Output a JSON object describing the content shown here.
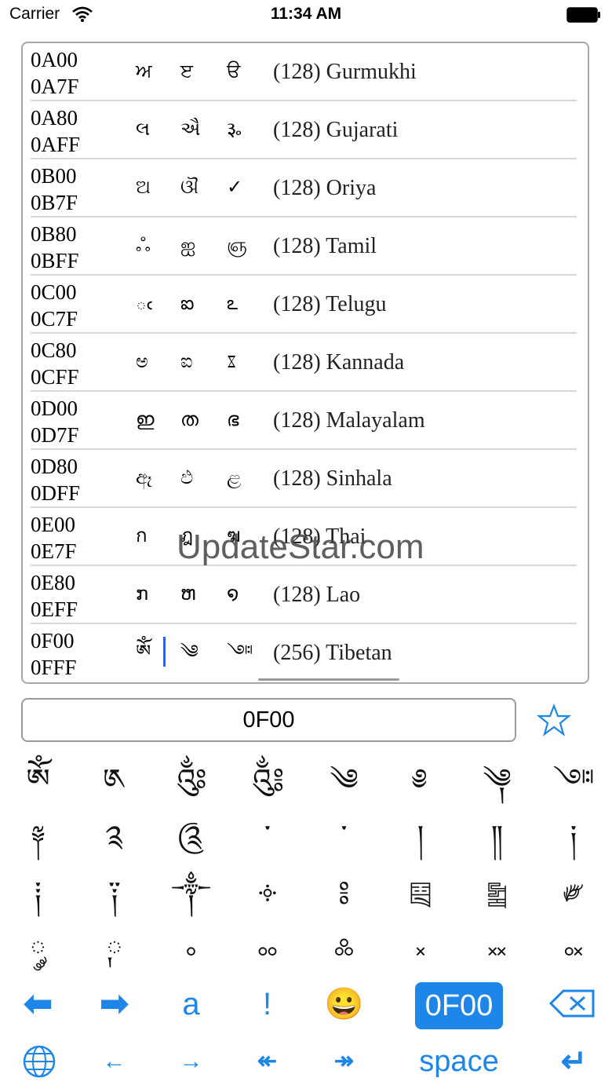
{
  "status": {
    "carrier": "Carrier",
    "time": "11:34 AM"
  },
  "rows": [
    {
      "start": "0A00",
      "end": "0A7F",
      "g1": "ਅ",
      "g2": "ੲ",
      "g3": "ੳ",
      "name": "(128) Gurmukhi"
    },
    {
      "start": "0A80",
      "end": "0AFF",
      "g1": "લ",
      "g2": "ઐ",
      "g3": "૱",
      "name": "(128) Gujarati"
    },
    {
      "start": "0B00",
      "end": "0B7F",
      "g1": "ଅ",
      "g2": "ଔ",
      "g3": "✓",
      "name": "(128) Oriya"
    },
    {
      "start": "0B80",
      "end": "0BFF",
      "g1": "ஃ",
      "g2": "ஐ",
      "g3": "ஞ",
      "name": "(128) Tamil"
    },
    {
      "start": "0C00",
      "end": "0C7F",
      "g1": "ఁ",
      "g2": "ఐ",
      "g3": "ఽ",
      "name": "(128) Telugu"
    },
    {
      "start": "0C80",
      "end": "0CFF",
      "g1": "ಅ",
      "g2": "ಐ",
      "g3": "ೱ",
      "name": "(128) Kannada"
    },
    {
      "start": "0D00",
      "end": "0D7F",
      "g1": "ഇ",
      "g2": "ത",
      "g3": "ഭ",
      "name": "(128) Malayalam"
    },
    {
      "start": "0D80",
      "end": "0DFF",
      "g1": "ඈ",
      "g2": "ඵ",
      "g3": "ළ",
      "name": "(128) Sinhala"
    },
    {
      "start": "0E00",
      "end": "0E7F",
      "g1": "ก",
      "g2": "ฎ",
      "g3": "ฆ",
      "name": "(128) Thai"
    },
    {
      "start": "0E80",
      "end": "0EFF",
      "g1": "ກ",
      "g2": "ຫ",
      "g3": "໑",
      "name": "(128) Lao"
    },
    {
      "start": "0F00",
      "end": "0FFF",
      "g1": "ༀ",
      "g2": "༄",
      "g3": "༇",
      "name": "(256) Tibetan"
    }
  ],
  "watermark": "UpdateStar.com",
  "search": {
    "value": "0F00"
  },
  "grid": [
    "ༀ",
    "༁",
    "༂",
    "༃",
    "༄",
    "༅",
    "༆",
    "༇",
    "༈",
    "༉",
    "༊",
    "་",
    "༌",
    "།",
    "༎",
    "༏",
    "༐",
    "༑",
    "༒",
    "༓",
    "༔",
    "༕",
    "༖",
    "༗",
    "༘",
    "༙",
    "༚",
    "༛",
    "༜",
    "༝",
    "༞",
    "༟"
  ],
  "keyboard": {
    "row1": [
      "⬅",
      "➡",
      "a",
      "!",
      "😀",
      "0F00",
      "⌫"
    ],
    "row2": [
      "🌐",
      "←",
      "→",
      "↞",
      "↠",
      "space",
      "↵"
    ]
  },
  "colors": {
    "accent": "#1e86e8"
  }
}
